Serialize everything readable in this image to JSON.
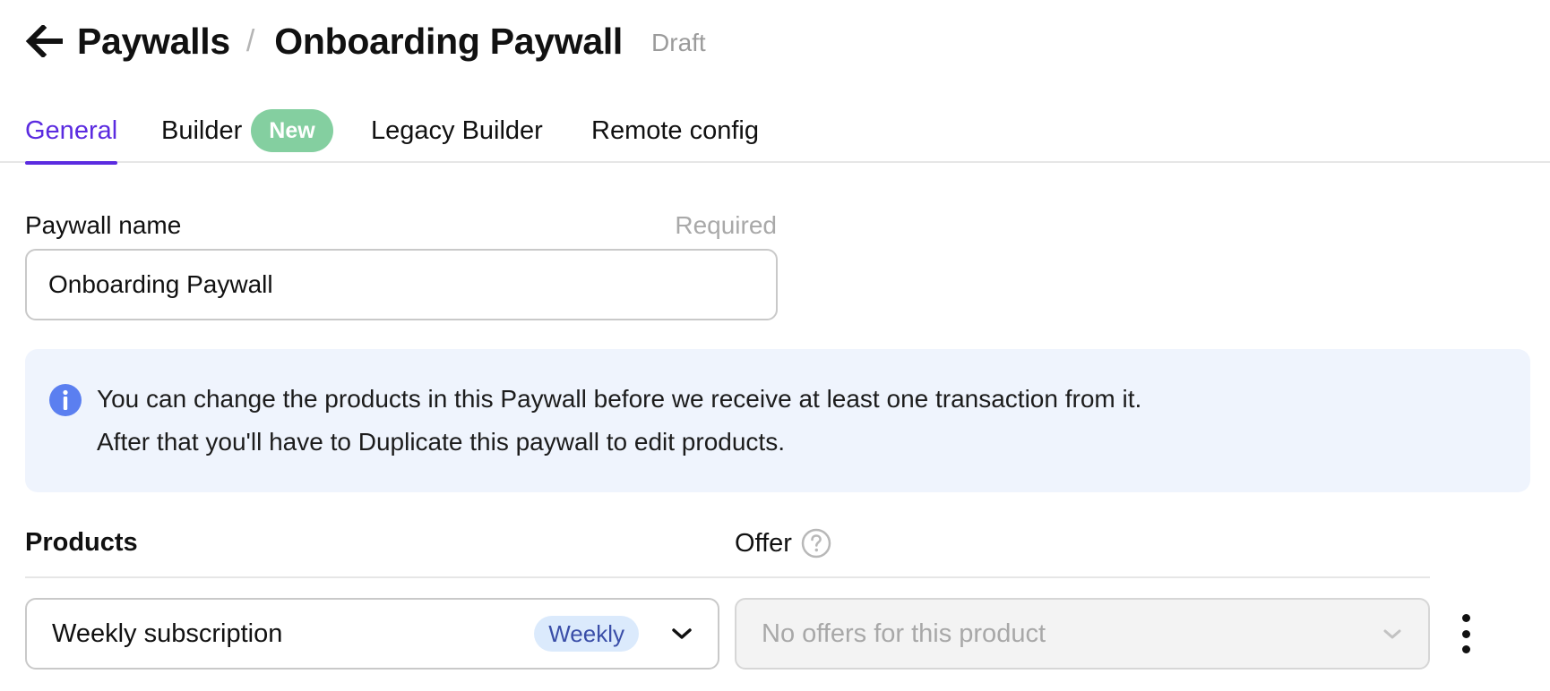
{
  "header": {
    "back_icon": "arrow-left-icon",
    "breadcrumb_parent": "Paywalls",
    "breadcrumb_separator": "/",
    "title": "Onboarding Paywall",
    "status": "Draft"
  },
  "tabs": [
    {
      "label": "General",
      "active": true
    },
    {
      "label": "Builder",
      "badge": "New"
    },
    {
      "label": "Legacy Builder"
    },
    {
      "label": "Remote config"
    }
  ],
  "form": {
    "name_label": "Paywall name",
    "name_required": "Required",
    "name_value": "Onboarding Paywall"
  },
  "info": {
    "icon": "info-icon",
    "line1": "You can change the products in this Paywall before we receive at least one transaction from it.",
    "line2": "After that you'll have to Duplicate this paywall to edit products."
  },
  "products": {
    "column_products": "Products",
    "column_offer": "Offer",
    "help_icon": "question-circle-icon",
    "rows": [
      {
        "product": "Weekly subscription",
        "period_badge": "Weekly",
        "offer_placeholder": "No offers for this product"
      }
    ]
  },
  "colors": {
    "accent": "#5b2be0",
    "new_badge": "#84cfa0",
    "info_bg": "#eff4fd",
    "info_icon": "#5b7ff0",
    "period_badge_bg": "#dbeafc"
  }
}
